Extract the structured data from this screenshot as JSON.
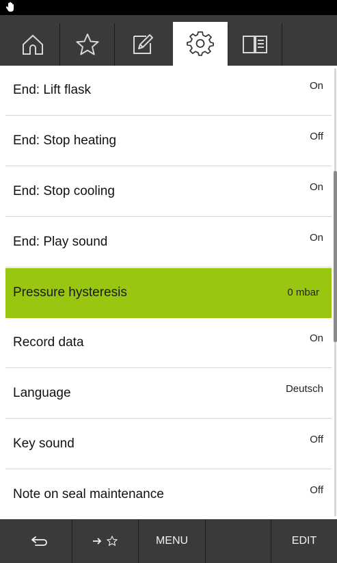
{
  "status_bar": {
    "icon": "hand-icon"
  },
  "tabs": [
    {
      "name": "home",
      "icon": "home-icon",
      "active": false
    },
    {
      "name": "favorites",
      "icon": "star-icon",
      "active": false
    },
    {
      "name": "edit",
      "icon": "edit-icon",
      "active": false
    },
    {
      "name": "settings",
      "icon": "gear-icon",
      "active": true
    },
    {
      "name": "manual",
      "icon": "book-icon",
      "active": false
    }
  ],
  "settings": {
    "rows": [
      {
        "label": "End: Lift flask",
        "value": "On"
      },
      {
        "label": "End: Stop heating",
        "value": "Off"
      },
      {
        "label": "End: Stop cooling",
        "value": "On"
      },
      {
        "label": "End: Play sound",
        "value": "On"
      },
      {
        "label": "Pressure hysteresis",
        "value": "0 mbar",
        "selected": true
      },
      {
        "label": "Record data",
        "value": "On"
      },
      {
        "label": "Language",
        "value": "Deutsch"
      },
      {
        "label": "Key sound",
        "value": "Off"
      },
      {
        "label": "Note on seal maintenance",
        "value": "Off"
      }
    ]
  },
  "bottom_bar": {
    "back_icon": "back-arrow-icon",
    "add_favorite_icon": "arrow-star-icon",
    "menu_label": "MENU",
    "empty_label": "",
    "edit_label": "EDIT"
  },
  "colors": {
    "highlight": "#99c610",
    "bar_background": "#3a3a3a",
    "status_bar": "#000000"
  }
}
